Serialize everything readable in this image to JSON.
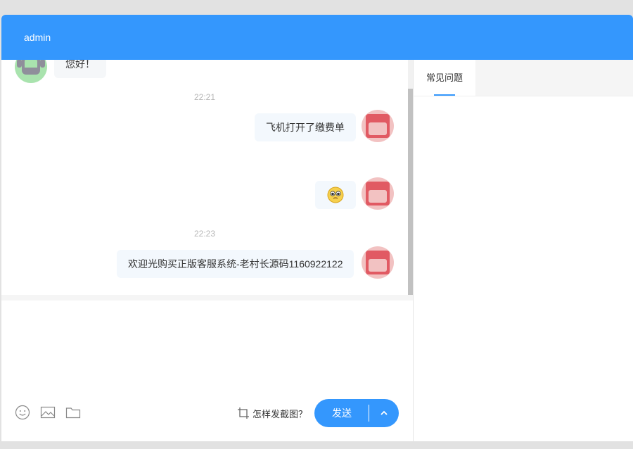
{
  "header": {
    "title": "admin"
  },
  "messages": [
    {
      "side": "left",
      "text": "您好！"
    },
    {
      "type": "time",
      "text": "22:21"
    },
    {
      "side": "right",
      "text": "飞机打开了缴费单"
    },
    {
      "side": "right",
      "emoji": "pleading-face-emoji"
    },
    {
      "type": "time",
      "text": "22:23"
    },
    {
      "side": "right",
      "text": "欢迎光购买正版客服系统-老村长源码1160922122"
    }
  ],
  "toolbar": {
    "icons": [
      "smiley-icon",
      "image-icon",
      "folder-icon"
    ],
    "screenshot_tip": "怎样发截图？",
    "send_label": "发送"
  },
  "side": {
    "tabs": [
      {
        "label": "常见问题"
      }
    ]
  },
  "colors": {
    "accent": "#3497fd",
    "bubble": "#f3f8fd",
    "robot_avatar": "#a9e3ae",
    "user_avatar": "#f2c2c2"
  }
}
